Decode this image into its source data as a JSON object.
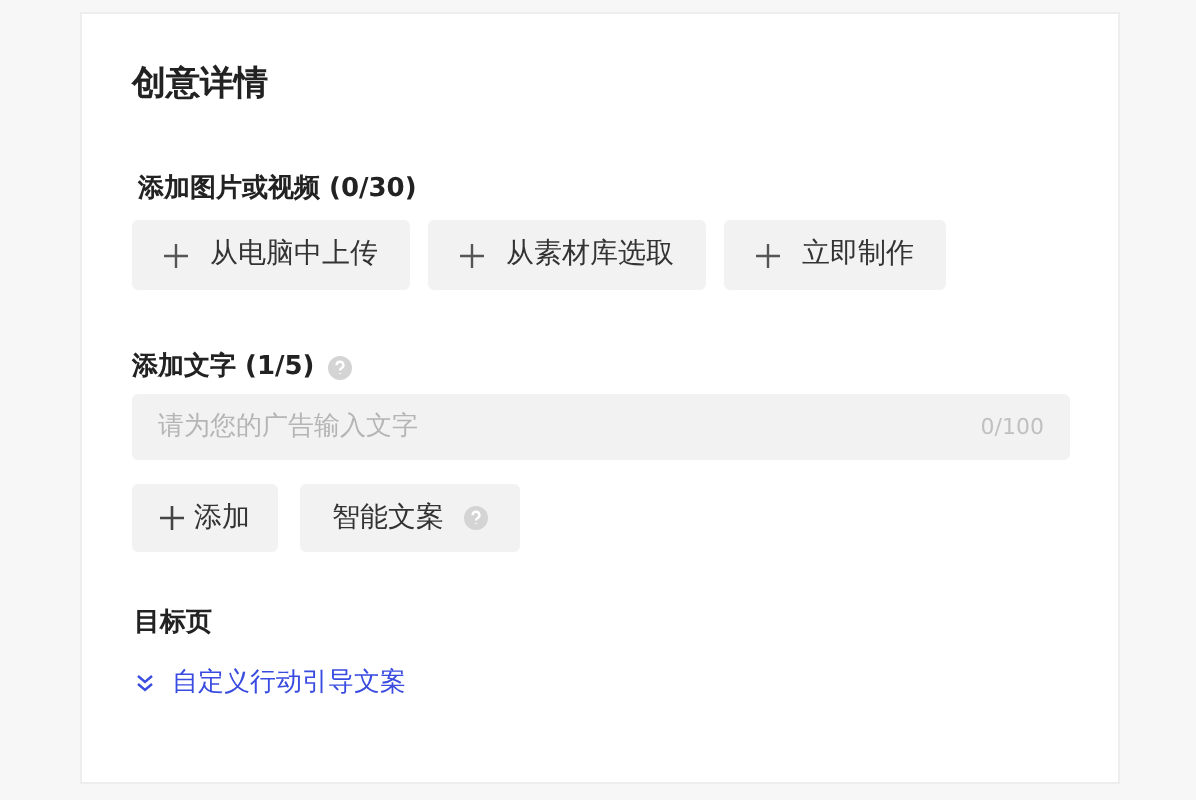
{
  "title": "创意详情",
  "media": {
    "label": "添加图片或视频 (0/30)",
    "buttons": [
      "从电脑中上传",
      "从素材库选取",
      "立即制作"
    ]
  },
  "text": {
    "label": "添加文字 (1/5)",
    "placeholder": "请为您的广告输入文字",
    "counter": "0/100",
    "add_button": "添加",
    "smart_button": "智能文案"
  },
  "landing": {
    "label": "目标页",
    "link": "自定义行动引导文案"
  }
}
